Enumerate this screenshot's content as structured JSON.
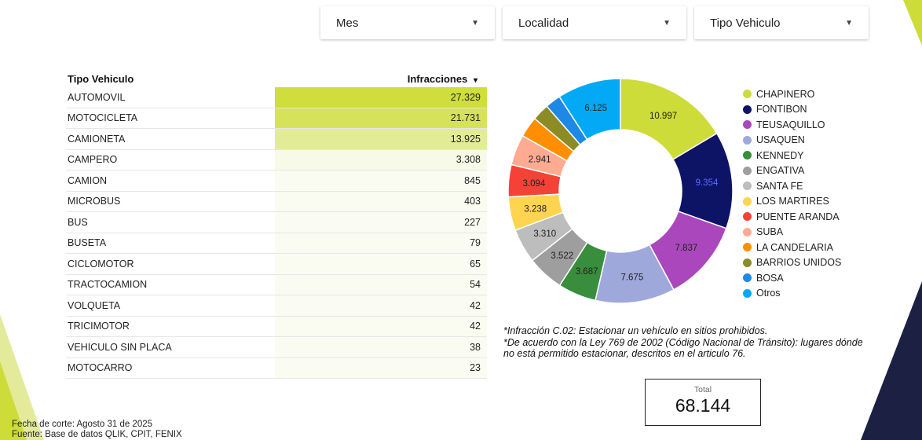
{
  "filters": {
    "mes": "Mes",
    "localidad": "Localidad",
    "tipo_vehiculo": "Tipo Vehiculo"
  },
  "table": {
    "col_tipo": "Tipo Vehiculo",
    "col_infracciones": "Infracciones",
    "sort_indicator": "▾",
    "rows": [
      {
        "tipo": "AUTOMOVIL",
        "infracciones": "27.329",
        "bg": "#cfde3c"
      },
      {
        "tipo": "MOTOCICLETA",
        "infracciones": "21.731",
        "bg": "#d6e25a"
      },
      {
        "tipo": "CAMIONETA",
        "infracciones": "13.925",
        "bg": "#e2ec97"
      },
      {
        "tipo": "CAMPERO",
        "infracciones": "3.308",
        "bg": "#f8fae8"
      },
      {
        "tipo": "CAMION",
        "infracciones": "845",
        "bg": "#fbfcf1"
      },
      {
        "tipo": "MICROBUS",
        "infracciones": "403",
        "bg": "#fbfcf1"
      },
      {
        "tipo": "BUS",
        "infracciones": "227",
        "bg": "#fbfcf1"
      },
      {
        "tipo": "BUSETA",
        "infracciones": "79",
        "bg": "#fbfcf1"
      },
      {
        "tipo": "CICLOMOTOR",
        "infracciones": "65",
        "bg": "#fbfcf1"
      },
      {
        "tipo": "TRACTOCAMION",
        "infracciones": "54",
        "bg": "#fbfcf1"
      },
      {
        "tipo": "VOLQUETA",
        "infracciones": "42",
        "bg": "#fbfcf1"
      },
      {
        "tipo": "TRICIMOTOR",
        "infracciones": "42",
        "bg": "#fbfcf1"
      },
      {
        "tipo": "VEHICULO SIN PLACA",
        "infracciones": "38",
        "bg": "#fbfcf1"
      },
      {
        "tipo": "MOTOCARRO",
        "infracciones": "23",
        "bg": "#fbfcf1"
      }
    ]
  },
  "chart_data": {
    "type": "pie",
    "series": [
      {
        "name": "CHAPINERO",
        "value": 10997,
        "label": "10.997",
        "color": "#cddc39",
        "label_color": "#222222"
      },
      {
        "name": "FONTIBON",
        "value": 9354,
        "label": "9.354",
        "color": "#0d1466",
        "label_color": "#5c6bff"
      },
      {
        "name": "TEUSAQUILLO",
        "value": 7837,
        "label": "7.837",
        "color": "#ab47bc",
        "label_color": "#222222"
      },
      {
        "name": "USAQUEN",
        "value": 7675,
        "label": "7.675",
        "color": "#9fa8da",
        "label_color": "#222222"
      },
      {
        "name": "KENNEDY",
        "value": 3687,
        "label": "3.687",
        "color": "#388e3c",
        "label_color": "#222222"
      },
      {
        "name": "ENGATIVA",
        "value": 3522,
        "label": "3.522",
        "color": "#9e9e9e",
        "label_color": "#222222"
      },
      {
        "name": "SANTA FE",
        "value": 3310,
        "label": "3.310",
        "color": "#bdbdbd",
        "label_color": "#222222"
      },
      {
        "name": "LOS MARTIRES",
        "value": 3238,
        "label": "3.238",
        "color": "#ffd54f",
        "label_color": "#222222"
      },
      {
        "name": "PUENTE ARANDA",
        "value": 3094,
        "label": "3.094",
        "color": "#f44336",
        "label_color": "#222222"
      },
      {
        "name": "SUBA",
        "value": 2941,
        "label": "2.941",
        "color": "#ffab91",
        "label_color": "#222222"
      },
      {
        "name": "LA CANDELARIA",
        "value": 2000,
        "label": "",
        "color": "#ff8f00",
        "label_color": "#222222"
      },
      {
        "name": "BARRIOS UNIDOS",
        "value": 1640,
        "label": "",
        "color": "#8d8b25",
        "label_color": "#222222"
      },
      {
        "name": "BOSA",
        "value": 1500,
        "label": "",
        "color": "#1e88e5",
        "label_color": "#222222"
      },
      {
        "name": "Otros",
        "value": 6125,
        "label": "6.125",
        "color": "#03a9f4",
        "label_color": "#222222"
      }
    ]
  },
  "note": {
    "line1": "*Infracción C.02: Estacionar un vehículo en sitios prohibidos.",
    "line2": "*De acuerdo con la Ley 769 de 2002 (Código Nacional de Tránsito): lugares dónde no está permitido estacionar, descritos en el articulo 76."
  },
  "total": {
    "label": "Total",
    "value": "68.144"
  },
  "footer": {
    "line1": "Fecha de corte: Agosto 31 de 2025",
    "line2": "Fuente: Base de datos QLIK, CPIT, FENIX"
  },
  "colors": {
    "accent_lime": "#cddc39",
    "navy": "#1c2143"
  }
}
